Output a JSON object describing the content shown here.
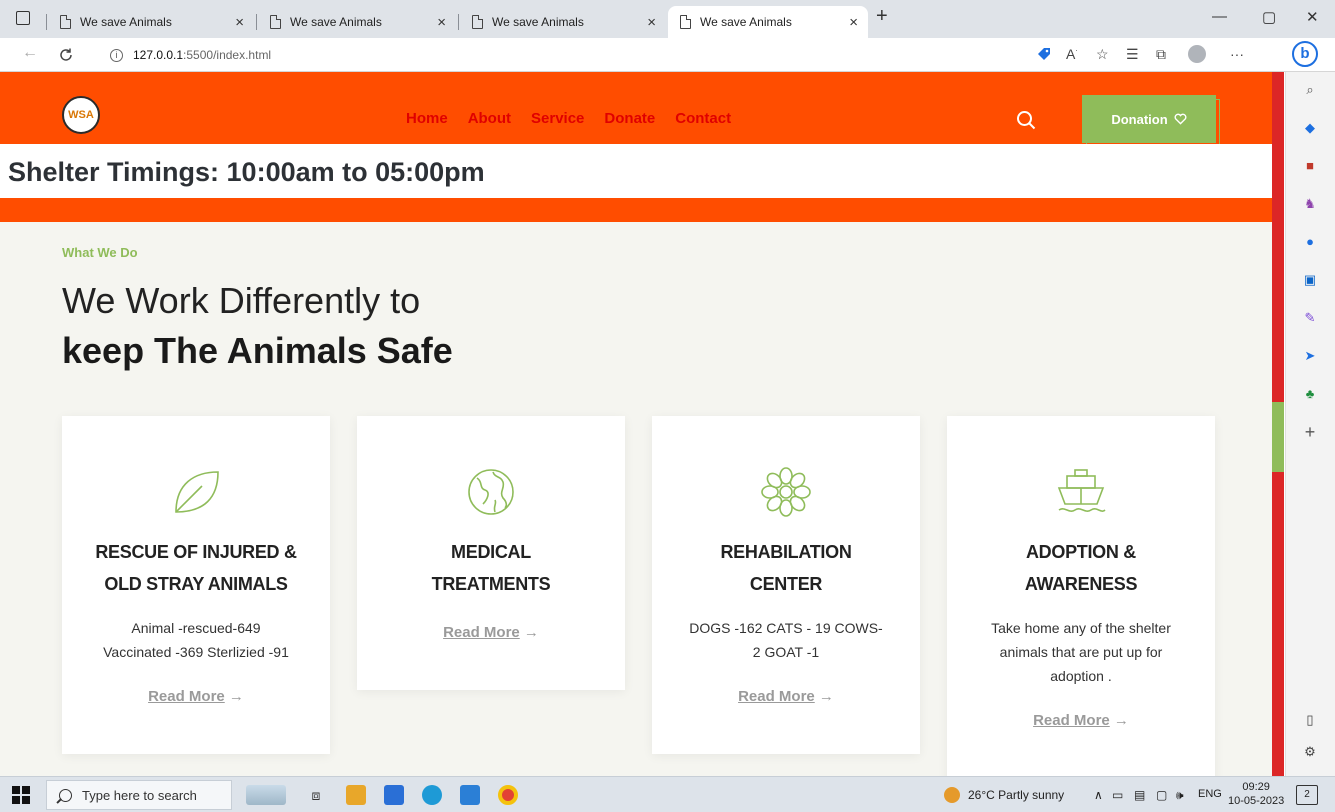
{
  "browser": {
    "tabs": [
      {
        "title": "We save Animals",
        "close": "×"
      },
      {
        "title": "We save Animals",
        "close": "×"
      },
      {
        "title": "We save Animals",
        "close": "×"
      },
      {
        "title": "We save Animals",
        "close": "×"
      }
    ],
    "new_tab": "+",
    "window": {
      "minimize": "—",
      "restore": "▢",
      "close": "✕"
    },
    "url_host": "127.0.0.1",
    "url_path": ":5500/index.html",
    "more": "···"
  },
  "site": {
    "logo_text": "WSA",
    "nav": [
      "Home",
      "About",
      "Service",
      "Donate",
      "Contact"
    ],
    "donation_label": "Donation",
    "donation_icon": "heart-outline",
    "shelter_timings": "Shelter Timings: 10:00am to 05:00pm",
    "section_tag": "What We Do",
    "title_line1": "We Work Differently to",
    "title_line2": "keep The Animals Safe",
    "cards": [
      {
        "icon": "leaf-icon",
        "title1": "RESCUE OF INJURED &",
        "title2": "OLD STRAY ANIMALS",
        "text1": "Animal -rescued-649",
        "text2": "Vaccinated -369 Sterlizied -91",
        "read_more": "Read More",
        "arrow": "→"
      },
      {
        "icon": "globe-icon",
        "title1": "MEDICAL",
        "title2": "TREATMENTS",
        "text1": "",
        "text2": "",
        "read_more": "Read More",
        "arrow": "→"
      },
      {
        "icon": "flower-icon",
        "title1": "REHABILATION",
        "title2": "CENTER",
        "text1": "DOGS -162 CATS - 19 COWS-",
        "text2": "2 GOAT -1",
        "read_more": "Read More",
        "arrow": "→"
      },
      {
        "icon": "ship-icon",
        "title1": "ADOPTION &",
        "title2": "AWARENESS",
        "text1": "Take home any of the shelter",
        "text2": "animals that are put up for",
        "text3": "adoption .",
        "read_more": "Read More",
        "arrow": "→"
      }
    ]
  },
  "taskbar": {
    "search_placeholder": "Type here to search",
    "weather": "26°C  Partly sunny",
    "language": "ENG",
    "time": "09:29",
    "date": "10-05-2023",
    "notifications": "2"
  },
  "colors": {
    "header_orange": "#ff4d00",
    "nav_red": "#e00000",
    "accent_green": "#8fbc5a",
    "scrollbar_red": "#dc2626"
  }
}
